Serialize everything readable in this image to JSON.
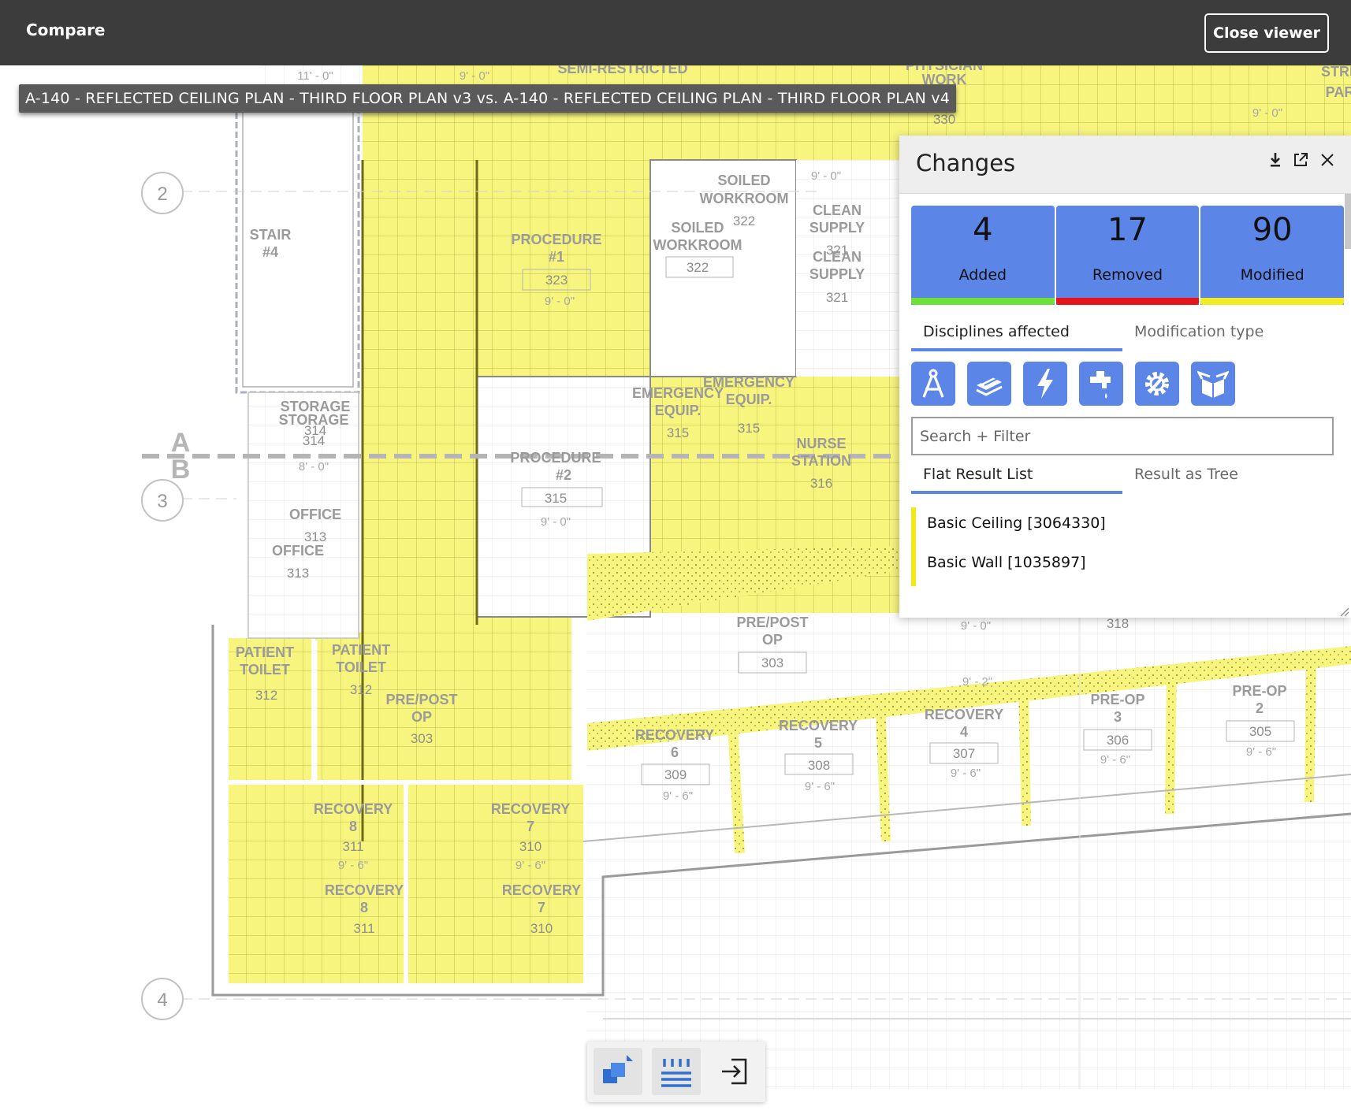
{
  "topbar": {
    "title": "Compare",
    "close_label": "Close viewer"
  },
  "file_compare_label": "A-140 - REFLECTED CEILING PLAN - THIRD FLOOR PLAN v3 vs. A-140 - REFLECTED CEILING PLAN - THIRD FLOOR PLAN v4",
  "panel": {
    "title": "Changes",
    "icons": [
      "download-icon",
      "external-link-icon",
      "close-icon"
    ],
    "stats": [
      {
        "count": "4",
        "label": "Added",
        "color": "#6fe03a"
      },
      {
        "count": "17",
        "label": "Removed",
        "color": "#e8141b"
      },
      {
        "count": "90",
        "label": "Modified",
        "color": "#f2ec25"
      }
    ],
    "filter_tabs": {
      "active": "Disciplines affected",
      "inactive": "Modification type"
    },
    "disciplines": [
      "architecture-compass-icon",
      "structural-layers-icon",
      "electrical-bolt-icon",
      "plumbing-faucet-icon",
      "mechanical-gear-icon",
      "generic-box-icon"
    ],
    "search_placeholder": "Search + Filter",
    "result_tabs": {
      "active": "Flat Result List",
      "inactive": "Result as Tree"
    },
    "results": [
      "Basic Ceiling [3064330]",
      "Basic Wall [1035897]"
    ]
  },
  "drawing": {
    "grid_markers": [
      "2",
      "3",
      "4"
    ],
    "section_marker": [
      "A",
      "B"
    ],
    "rooms": [
      {
        "name": "STAIR",
        "sub": "#4",
        "num": "",
        "height": ""
      },
      {
        "name": "PROCEDURE",
        "sub": "#1",
        "num": "323",
        "height": "9' - 0\""
      },
      {
        "name": "SOILED",
        "sub": "WORKROOM",
        "num": "322",
        "height": ""
      },
      {
        "name": "CLEAN",
        "sub": "SUPPLY",
        "num": "321",
        "height": ""
      },
      {
        "name": "STORAGE",
        "sub": "",
        "num": "314",
        "height": "8' - 0\""
      },
      {
        "name": "PROCEDURE",
        "sub": "#2",
        "num": "315",
        "height": "9' - 0\""
      },
      {
        "name": "EMERGENCY",
        "sub": "EQUIP.",
        "num": "315",
        "height": ""
      },
      {
        "name": "NURSE",
        "sub": "STATION",
        "num": "316",
        "height": ""
      },
      {
        "name": "OFFICE",
        "sub": "",
        "num": "313",
        "height": ""
      },
      {
        "name": "PATIENT",
        "sub": "TOILET",
        "num": "312",
        "height": ""
      },
      {
        "name": "PRE/POST",
        "sub": "OP",
        "num": "303",
        "height": ""
      },
      {
        "name": "RECOVERY",
        "sub": "6",
        "num": "309",
        "height": "9' - 6\""
      },
      {
        "name": "RECOVERY",
        "sub": "5",
        "num": "308",
        "height": "9' - 6\""
      },
      {
        "name": "RECOVERY",
        "sub": "4",
        "num": "307",
        "height": "9' - 6\""
      },
      {
        "name": "PRE-OP",
        "sub": "3",
        "num": "306",
        "height": "9' - 6\""
      },
      {
        "name": "PRE-OP",
        "sub": "2",
        "num": "305",
        "height": "9' - 6\""
      },
      {
        "name": "RECOVERY",
        "sub": "8",
        "num": "311",
        "height": "9' - 6\""
      },
      {
        "name": "RECOVERY",
        "sub": "7",
        "num": "310",
        "height": "9' - 6\""
      }
    ],
    "top_labels": {
      "left_height": "11' - 0\"",
      "mid_height": "9' - 0\"",
      "semi": "SEMI-RESTRICTED",
      "physician": "PHYSICIAN",
      "work": "WORK",
      "corridor_num": "330",
      "far_height": "9' - 0\"",
      "stre": "STRE",
      "par": "PAR",
      "soiled_height": "9' - 0\"",
      "misc_318": "318",
      "misc_ht": "9' - 2\"",
      "pre_post_ht": "9' - 0\""
    }
  },
  "toolbar": {
    "buttons": [
      "overlay-compare-icon",
      "side-by-side-icon",
      "exit-compare-icon"
    ]
  },
  "colors": {
    "change_yellow": "#f7f57e",
    "accent_blue": "#5b85e6",
    "topbar": "#3c3c3c"
  }
}
